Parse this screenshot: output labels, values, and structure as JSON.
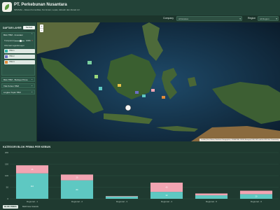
{
  "header": {
    "company": "PT. Perkebunan Nusantara",
    "subtitle": "SPASIAL - Aksesi Komoditas, Nominasi, Lepas, Aktualn dan Aktual.mil"
  },
  "filters": {
    "company_label": "Company",
    "company_value": "All Estates",
    "region_label": "Region",
    "region_value": "All Region"
  },
  "layers": {
    "title": "DAFTAR LAYER",
    "button": "Tambah Layer",
    "section1": {
      "title": "Blok TBM - Investasi",
      "transparency_label": "Transparency",
      "transparency_value": "100%",
      "transparency": 0.5,
      "legend_title": "Informasi Legenda Layer",
      "items": [
        {
          "label": "TBM 1",
          "color": "#2fb5a8"
        },
        {
          "label": "TBM 2",
          "color": "#6a6fc4"
        },
        {
          "label": "TBM 3",
          "color": "#e08b3a"
        }
      ]
    },
    "section2": {
      "title": "Blok TBM - Budaya Prima"
    },
    "section3": {
      "title": "Titik Pohon TBM"
    },
    "section4": {
      "title": "Lingkar Topik TBM"
    }
  },
  "map": {
    "zoom_in": "+",
    "zoom_out": "−",
    "attribution": "Leaflet | Esri, Maxar, Earthstar Geographics, USDA FSA, USGS, Aerogrid, IGN, IGP, and the GIS User Community"
  },
  "chart": {
    "title": "KATEGORI BLOK PRIMA PER KEBUN",
    "colors": {
      "base": "#5ec8c2",
      "top": "#f2a4b2"
    },
    "chart_data": {
      "type": "bar",
      "categories": [
        "Regional - 1",
        "Regional - 2",
        "Regional - 3",
        "Regional - 4",
        "Regional - 5",
        "Regional - 6"
      ],
      "series": [
        {
          "values": [
            110,
            80,
            10,
            30,
            15,
            20
          ]
        },
        {
          "values": [
            35,
            25,
            2,
            40,
            8,
            15
          ]
        }
      ],
      "ylim": [
        0,
        200
      ],
      "yticks": [
        0,
        50,
        100,
        150,
        200
      ]
    }
  },
  "footer": {
    "badge": "BLOK PRIMA",
    "text": "BER Data Statistik"
  }
}
